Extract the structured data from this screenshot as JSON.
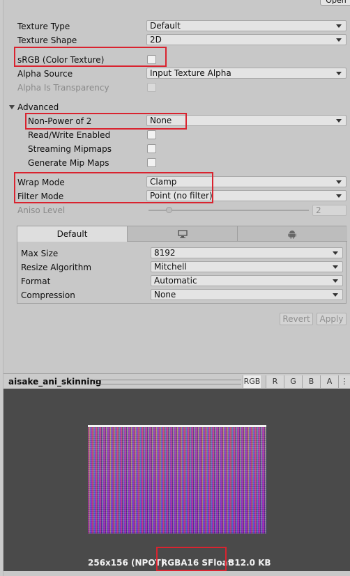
{
  "header": {
    "open_label": "Open"
  },
  "fields": {
    "texture_type": {
      "label": "Texture Type",
      "value": "Default"
    },
    "texture_shape": {
      "label": "Texture Shape",
      "value": "2D"
    },
    "srgb": {
      "label": "sRGB (Color Texture)"
    },
    "alpha_source": {
      "label": "Alpha Source",
      "value": "Input Texture Alpha"
    },
    "alpha_transparency": {
      "label": "Alpha Is Transparency"
    },
    "advanced": {
      "label": "Advanced"
    },
    "npot": {
      "label": "Non-Power of 2",
      "value": "None"
    },
    "read_write": {
      "label": "Read/Write Enabled"
    },
    "streaming": {
      "label": "Streaming Mipmaps"
    },
    "mipmaps": {
      "label": "Generate Mip Maps"
    },
    "wrap_mode": {
      "label": "Wrap Mode",
      "value": "Clamp"
    },
    "filter_mode": {
      "label": "Filter Mode",
      "value": "Point (no filter)"
    },
    "aniso": {
      "label": "Aniso Level",
      "value": "2"
    }
  },
  "platform": {
    "tabs": [
      {
        "label": "Default",
        "icon": ""
      },
      {
        "label": "",
        "icon": "monitor-icon"
      },
      {
        "label": "",
        "icon": "android-icon"
      }
    ],
    "rows": [
      {
        "label": "Max Size",
        "value": "8192"
      },
      {
        "label": "Resize Algorithm",
        "value": "Mitchell"
      },
      {
        "label": "Format",
        "value": "Automatic"
      },
      {
        "label": "Compression",
        "value": "None"
      }
    ]
  },
  "actions": {
    "revert": "Revert",
    "apply": "Apply"
  },
  "preview": {
    "title": "aisake_ani_skinning",
    "channels": [
      "RGB",
      "R",
      "G",
      "B",
      "A"
    ],
    "active_channel": "RGB",
    "info_size": "256x156 (NPOT)",
    "info_format": "RGBA16 SFloat",
    "info_memory": "312.0 KB"
  },
  "colors": {
    "highlight": "#d9232f",
    "preview_bg": "#4a4a4a",
    "panel_bg": "#c8c8c8"
  }
}
